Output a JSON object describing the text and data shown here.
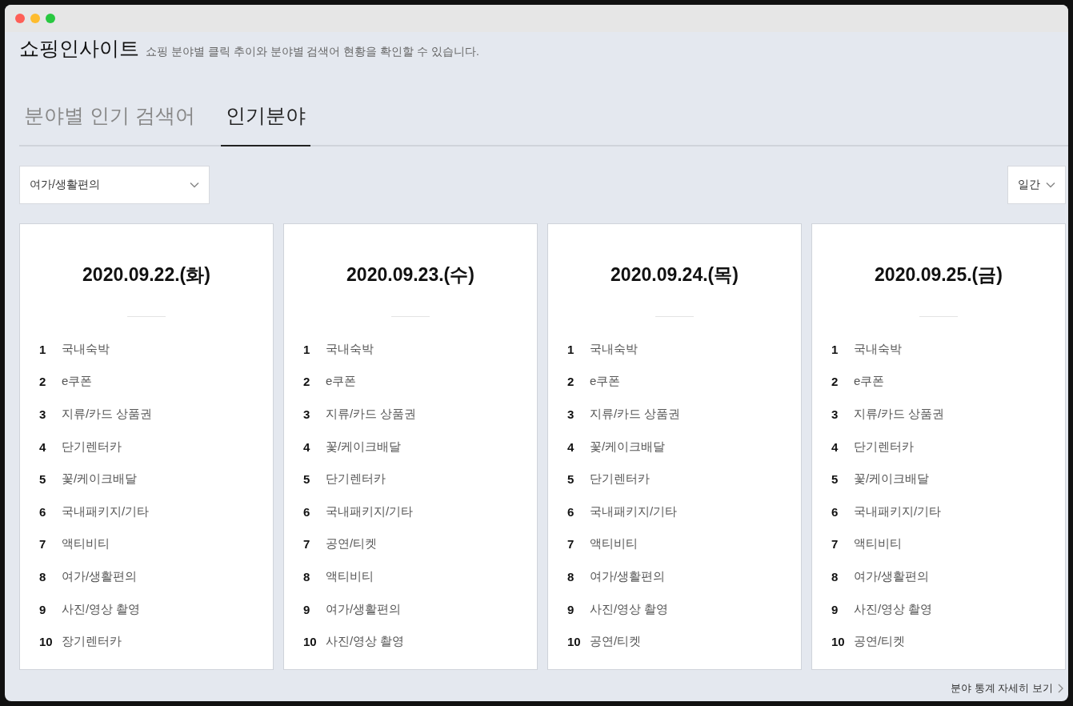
{
  "header": {
    "title": "쇼핑인사이트",
    "subtitle": "쇼핑 분야별 클릭 추이와 분야별 검색어 현황을 확인할 수 있습니다."
  },
  "tabs": [
    {
      "label": "분야별 인기 검색어",
      "selected": false
    },
    {
      "label": "인기분야",
      "selected": true
    }
  ],
  "category_select": {
    "value": "여가/생활편의"
  },
  "period_select": {
    "value": "일간"
  },
  "days": [
    {
      "date": "2020.09.22.(화)",
      "rankings": [
        {
          "rank": "1",
          "name": "국내숙박"
        },
        {
          "rank": "2",
          "name": "e쿠폰"
        },
        {
          "rank": "3",
          "name": "지류/카드 상품권"
        },
        {
          "rank": "4",
          "name": "단기렌터카"
        },
        {
          "rank": "5",
          "name": "꽃/케이크배달"
        },
        {
          "rank": "6",
          "name": "국내패키지/기타"
        },
        {
          "rank": "7",
          "name": "액티비티"
        },
        {
          "rank": "8",
          "name": "여가/생활편의"
        },
        {
          "rank": "9",
          "name": "사진/영상 촬영"
        },
        {
          "rank": "10",
          "name": "장기렌터카"
        }
      ]
    },
    {
      "date": "2020.09.23.(수)",
      "rankings": [
        {
          "rank": "1",
          "name": "국내숙박"
        },
        {
          "rank": "2",
          "name": "e쿠폰"
        },
        {
          "rank": "3",
          "name": "지류/카드 상품권"
        },
        {
          "rank": "4",
          "name": "꽃/케이크배달"
        },
        {
          "rank": "5",
          "name": "단기렌터카"
        },
        {
          "rank": "6",
          "name": "국내패키지/기타"
        },
        {
          "rank": "7",
          "name": "공연/티켓"
        },
        {
          "rank": "8",
          "name": "액티비티"
        },
        {
          "rank": "9",
          "name": "여가/생활편의"
        },
        {
          "rank": "10",
          "name": "사진/영상 촬영"
        }
      ]
    },
    {
      "date": "2020.09.24.(목)",
      "rankings": [
        {
          "rank": "1",
          "name": "국내숙박"
        },
        {
          "rank": "2",
          "name": "e쿠폰"
        },
        {
          "rank": "3",
          "name": "지류/카드 상품권"
        },
        {
          "rank": "4",
          "name": "꽃/케이크배달"
        },
        {
          "rank": "5",
          "name": "단기렌터카"
        },
        {
          "rank": "6",
          "name": "국내패키지/기타"
        },
        {
          "rank": "7",
          "name": "액티비티"
        },
        {
          "rank": "8",
          "name": "여가/생활편의"
        },
        {
          "rank": "9",
          "name": "사진/영상 촬영"
        },
        {
          "rank": "10",
          "name": "공연/티켓"
        }
      ]
    },
    {
      "date": "2020.09.25.(금)",
      "rankings": [
        {
          "rank": "1",
          "name": "국내숙박"
        },
        {
          "rank": "2",
          "name": "e쿠폰"
        },
        {
          "rank": "3",
          "name": "지류/카드 상품권"
        },
        {
          "rank": "4",
          "name": "단기렌터카"
        },
        {
          "rank": "5",
          "name": "꽃/케이크배달"
        },
        {
          "rank": "6",
          "name": "국내패키지/기타"
        },
        {
          "rank": "7",
          "name": "액티비티"
        },
        {
          "rank": "8",
          "name": "여가/생활편의"
        },
        {
          "rank": "9",
          "name": "사진/영상 촬영"
        },
        {
          "rank": "10",
          "name": "공연/티켓"
        }
      ]
    }
  ],
  "detail_link": {
    "label": "분야 통계 자세히 보기"
  }
}
